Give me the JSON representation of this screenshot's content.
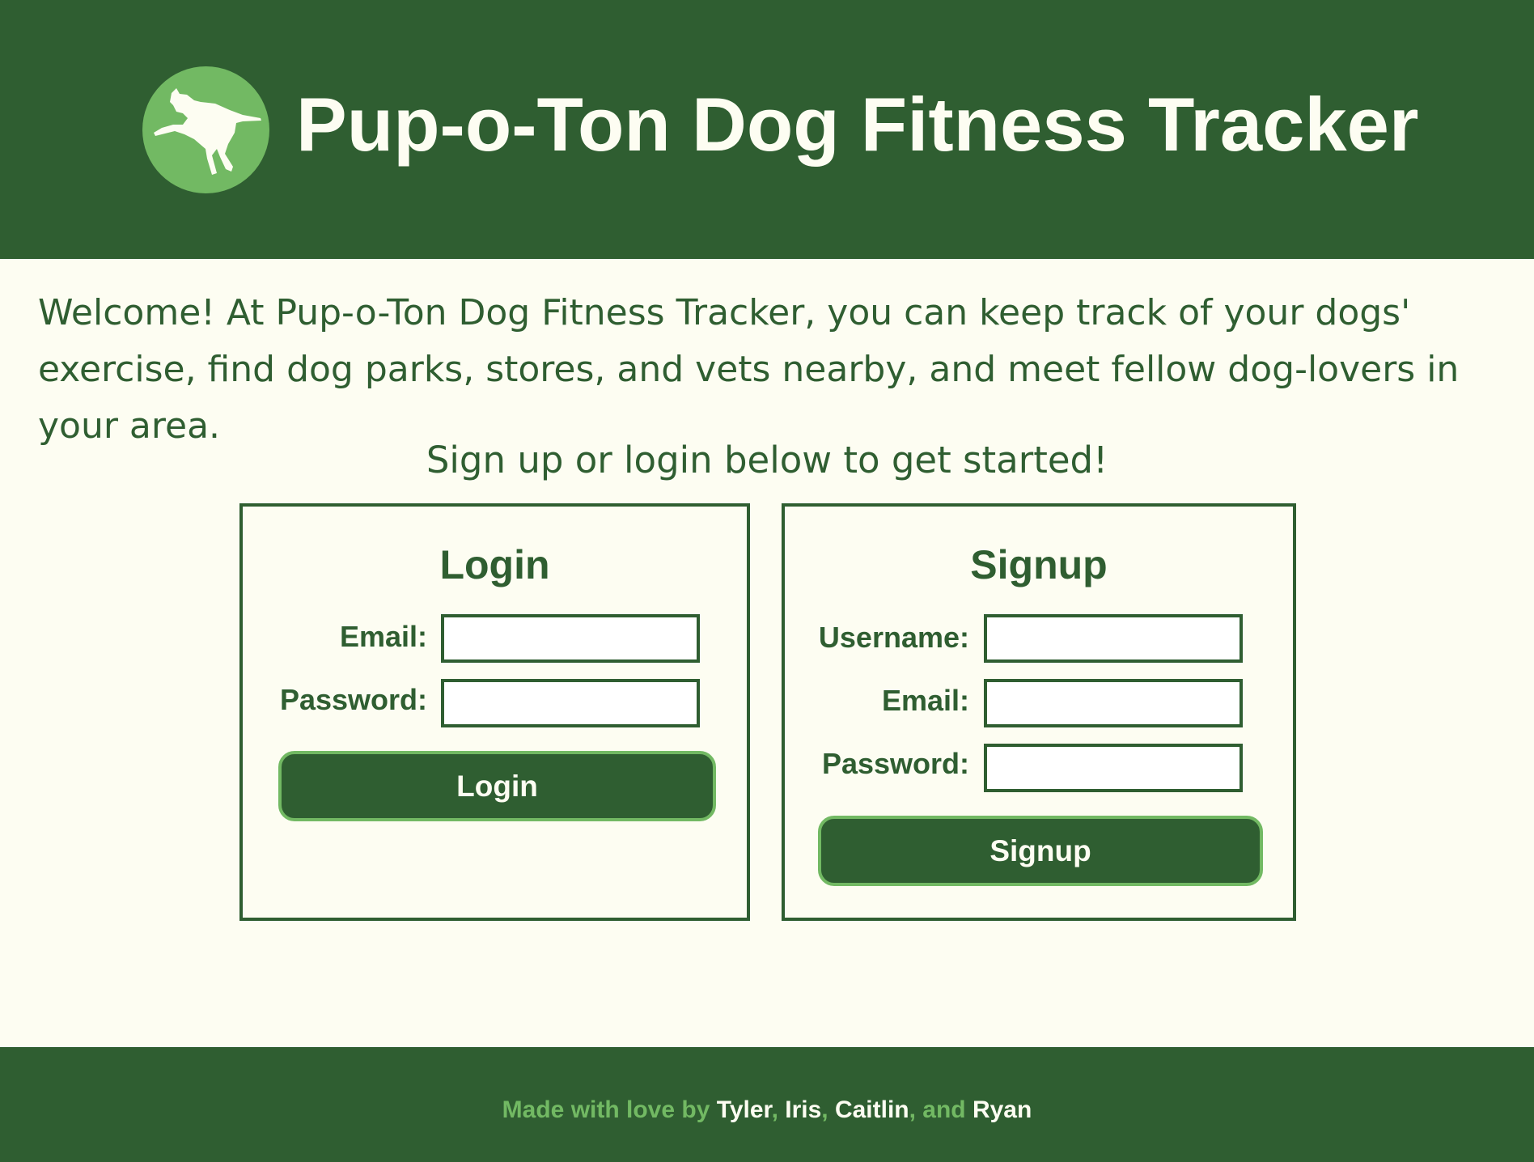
{
  "header": {
    "title": "Pup-o-Ton Dog Fitness Tracker",
    "logo_icon": "running-dog-icon"
  },
  "intro": {
    "welcome": "Welcome! At Pup-o-Ton Dog Fitness Tracker, you can keep track of your dogs' exercise, find dog parks, stores, and vets nearby, and meet fellow dog-lovers in your area.",
    "prompt": "Sign up or login below to get started!"
  },
  "login": {
    "title": "Login",
    "email_label": "Email:",
    "email_value": "",
    "password_label": "Password:",
    "password_value": "",
    "button_label": "Login"
  },
  "signup": {
    "title": "Signup",
    "username_label": "Username:",
    "username_value": "",
    "email_label": "Email:",
    "email_value": "",
    "password_label": "Password:",
    "password_value": "",
    "button_label": "Signup"
  },
  "footer": {
    "prefix": "Made with love by ",
    "names": [
      "Tyler",
      "Iris",
      "Caitlin",
      "Ryan"
    ],
    "sep1": ", ",
    "sep2": ", ",
    "sep3": ", and "
  },
  "colors": {
    "primary_dark_green": "#2f5e31",
    "accent_light_green": "#72b963",
    "background_cream": "#fdfdf2",
    "input_background": "#ffffff"
  }
}
